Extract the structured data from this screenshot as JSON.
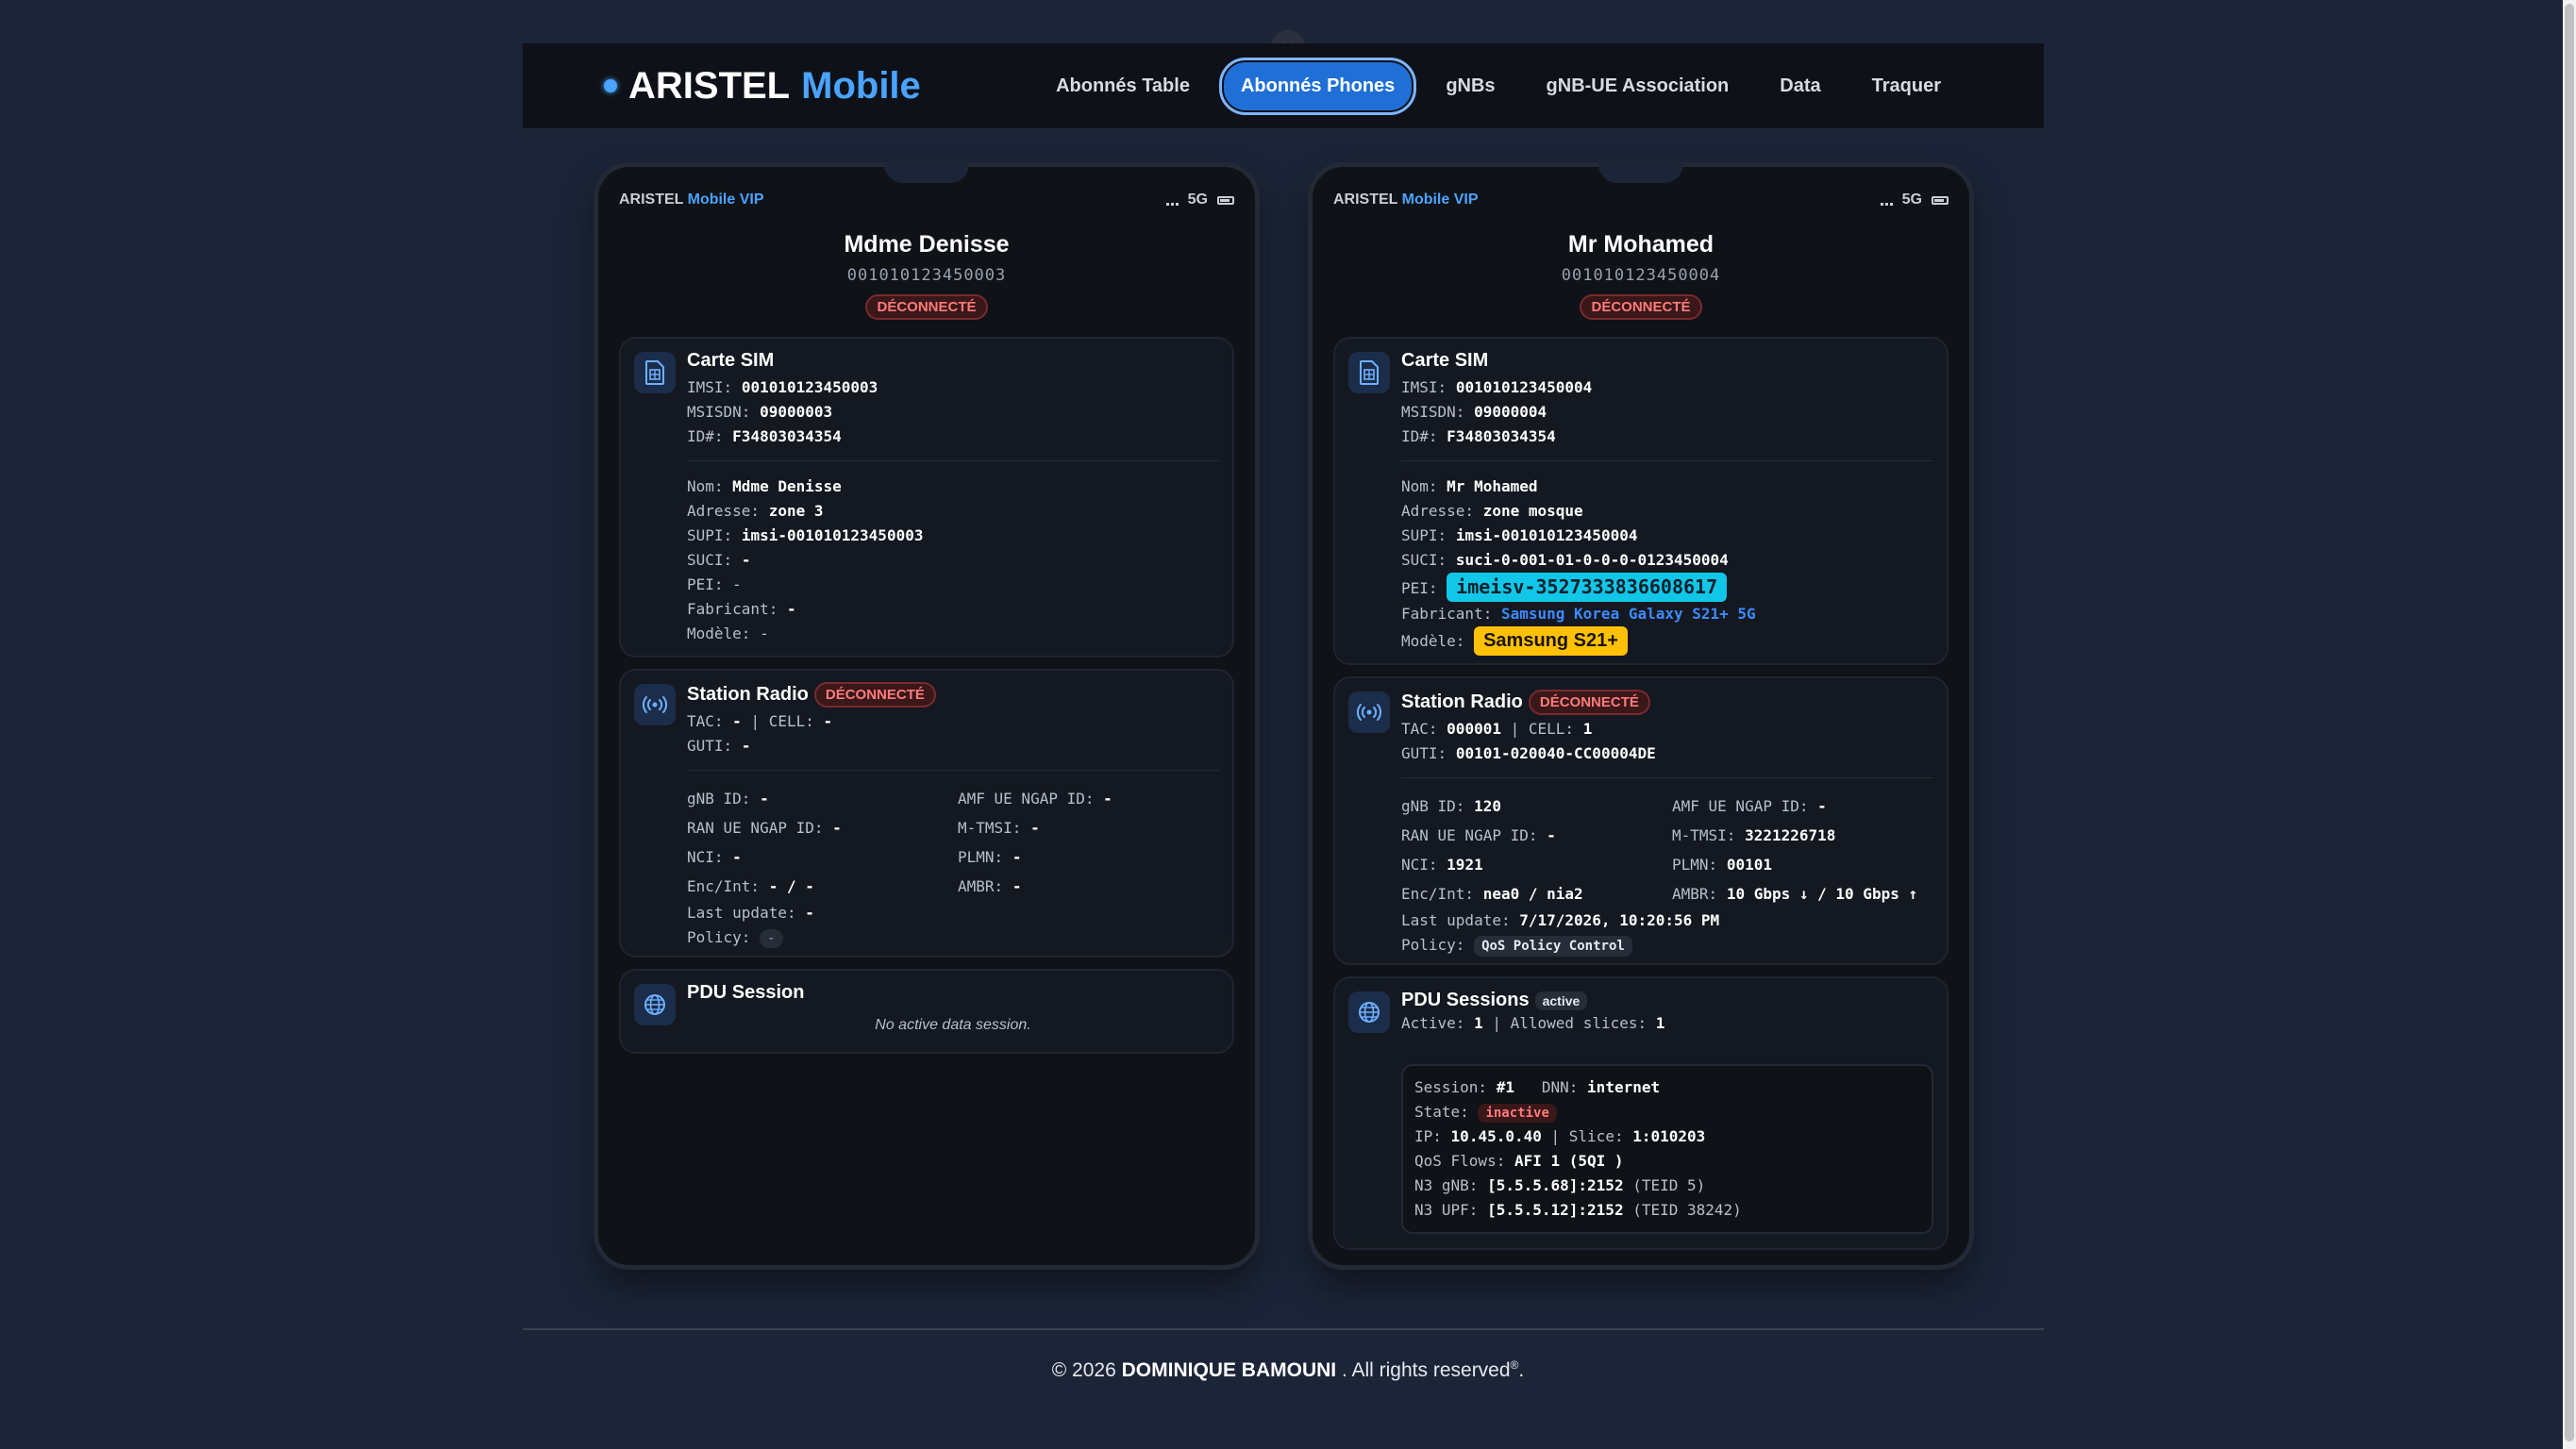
{
  "nav": {
    "brand": "ARISTEL",
    "brand_accent": "Mobile",
    "links": [
      "Abonnés Table",
      "Abonnés Phones",
      "gNBs",
      "gNB-UE Association",
      "Data",
      "Traquer"
    ],
    "active_index": 1,
    "close_label": "×"
  },
  "phones": [
    {
      "status_brand": "ARISTEL",
      "status_accent": "Mobile VIP",
      "network": "5G",
      "name": "Mdme Denisse",
      "number": "001010123450003",
      "state": "DÉCONNECTÉ",
      "sim": {
        "title": "Carte SIM",
        "imsi_label": "IMSI:",
        "imsi": "001010123450003",
        "msisdn_label": "MSISDN:",
        "msisdn": "09000003",
        "id_label": "ID#:",
        "id": "F34803034354",
        "nom_label": "Nom:",
        "nom": "Mdme Denisse",
        "adresse_label": "Adresse:",
        "adresse": "zone 3",
        "supi_label": "SUPI:",
        "supi": "imsi-001010123450003",
        "suci_label": "SUCI:",
        "suci": "-",
        "pei_label": "PEI:",
        "pei": "-",
        "fabricant_label": "Fabricant:",
        "fabricant": "-",
        "modele_label": "Modèle:",
        "modele": "-"
      },
      "radio": {
        "title": "Station Radio",
        "state": "DÉCONNECTÉ",
        "tac_label": "TAC:",
        "tac": "-",
        "cell_label": "| CELL:",
        "cell": "-",
        "guti_label": "GUTI:",
        "guti": "-",
        "gnb_id_label": "gNB ID:",
        "gnb_id": "-",
        "amf_label": "AMF UE NGAP ID:",
        "amf": "-",
        "ran_label": "RAN UE NGAP ID:",
        "ran": "-",
        "mtmsi_label": "M-TMSI:",
        "mtmsi": "-",
        "nci_label": "NCI:",
        "nci": "-",
        "plmn_label": "PLMN:",
        "plmn": "-",
        "enc_label": "Enc/Int:",
        "enc": "- / -",
        "ambr_label": "AMBR:",
        "ambr": "-",
        "last_label": "Last update:",
        "last": "-",
        "policy_label": "Policy:",
        "policy": "-"
      },
      "pdu": {
        "title": "PDU Session",
        "empty": "No active data session."
      }
    },
    {
      "status_brand": "ARISTEL",
      "status_accent": "Mobile VIP",
      "network": "5G",
      "name": "Mr Mohamed",
      "number": "001010123450004",
      "state": "DÉCONNECTÉ",
      "sim": {
        "title": "Carte SIM",
        "imsi_label": "IMSI:",
        "imsi": "001010123450004",
        "msisdn_label": "MSISDN:",
        "msisdn": "09000004",
        "id_label": "ID#:",
        "id": "F34803034354",
        "nom_label": "Nom:",
        "nom": "Mr Mohamed",
        "adresse_label": "Adresse:",
        "adresse": "zone mosque",
        "supi_label": "SUPI:",
        "supi": "imsi-001010123450004",
        "suci_label": "SUCI:",
        "suci": "suci-0-001-01-0-0-0-0123450004",
        "pei_label": "PEI:",
        "pei": "imeisv-3527333836608617",
        "fabricant_label": "Fabricant:",
        "fabricant": "Samsung Korea Galaxy S21+ 5G",
        "modele_label": "Modèle:",
        "modele": "Samsung S21+"
      },
      "radio": {
        "title": "Station Radio",
        "state": "DÉCONNECTÉ",
        "tac_label": "TAC:",
        "tac": "000001",
        "cell_label": "| CELL:",
        "cell": "1",
        "guti_label": "GUTI:",
        "guti": "00101-020040-CC00004DE",
        "gnb_id_label": "gNB ID:",
        "gnb_id": "120",
        "amf_label": "AMF UE NGAP ID:",
        "amf": "-",
        "ran_label": "RAN UE NGAP ID:",
        "ran": "-",
        "mtmsi_label": "M-TMSI:",
        "mtmsi": "3221226718",
        "nci_label": "NCI:",
        "nci": "1921",
        "plmn_label": "PLMN:",
        "plmn": "00101",
        "enc_label": "Enc/Int:",
        "enc": "nea0 / nia2",
        "ambr_label": "AMBR:",
        "ambr": "10 Gbps ↓ / 10 Gbps ↑",
        "last_label": "Last update:",
        "last": "7/17/2026, 10:20:56 PM",
        "policy_label": "Policy:",
        "policy": "QoS Policy Control"
      },
      "pdu": {
        "title": "PDU Sessions",
        "badge": "active",
        "active_label": "Active:",
        "active": "1",
        "slices_label": "| Allowed slices:",
        "slices": "1",
        "session_label": "Session:",
        "session": "#1",
        "dnn_label": "DNN:",
        "dnn": "internet",
        "state_label": "State:",
        "state": "inactive",
        "ip_label": "IP:",
        "ip": "10.45.0.40",
        "slice_label": "| Slice:",
        "slice": "1:010203",
        "qos_label": "QoS Flows:",
        "qos": "AFI 1 (5QI )",
        "n3gnb_label": "N3 gNB:",
        "n3gnb": "[5.5.5.68]:2152",
        "n3gnb_teid": "(TEID 5)",
        "n3upf_label": "N3 UPF:",
        "n3upf": "[5.5.5.12]:2152",
        "n3upf_teid": "(TEID 38242)"
      }
    }
  ],
  "footer": {
    "prefix": "© 2026",
    "owner": "DOMINIQUE BAMOUNI",
    "suffix": ". All rights reserved",
    "mark": "®",
    "end": "."
  }
}
